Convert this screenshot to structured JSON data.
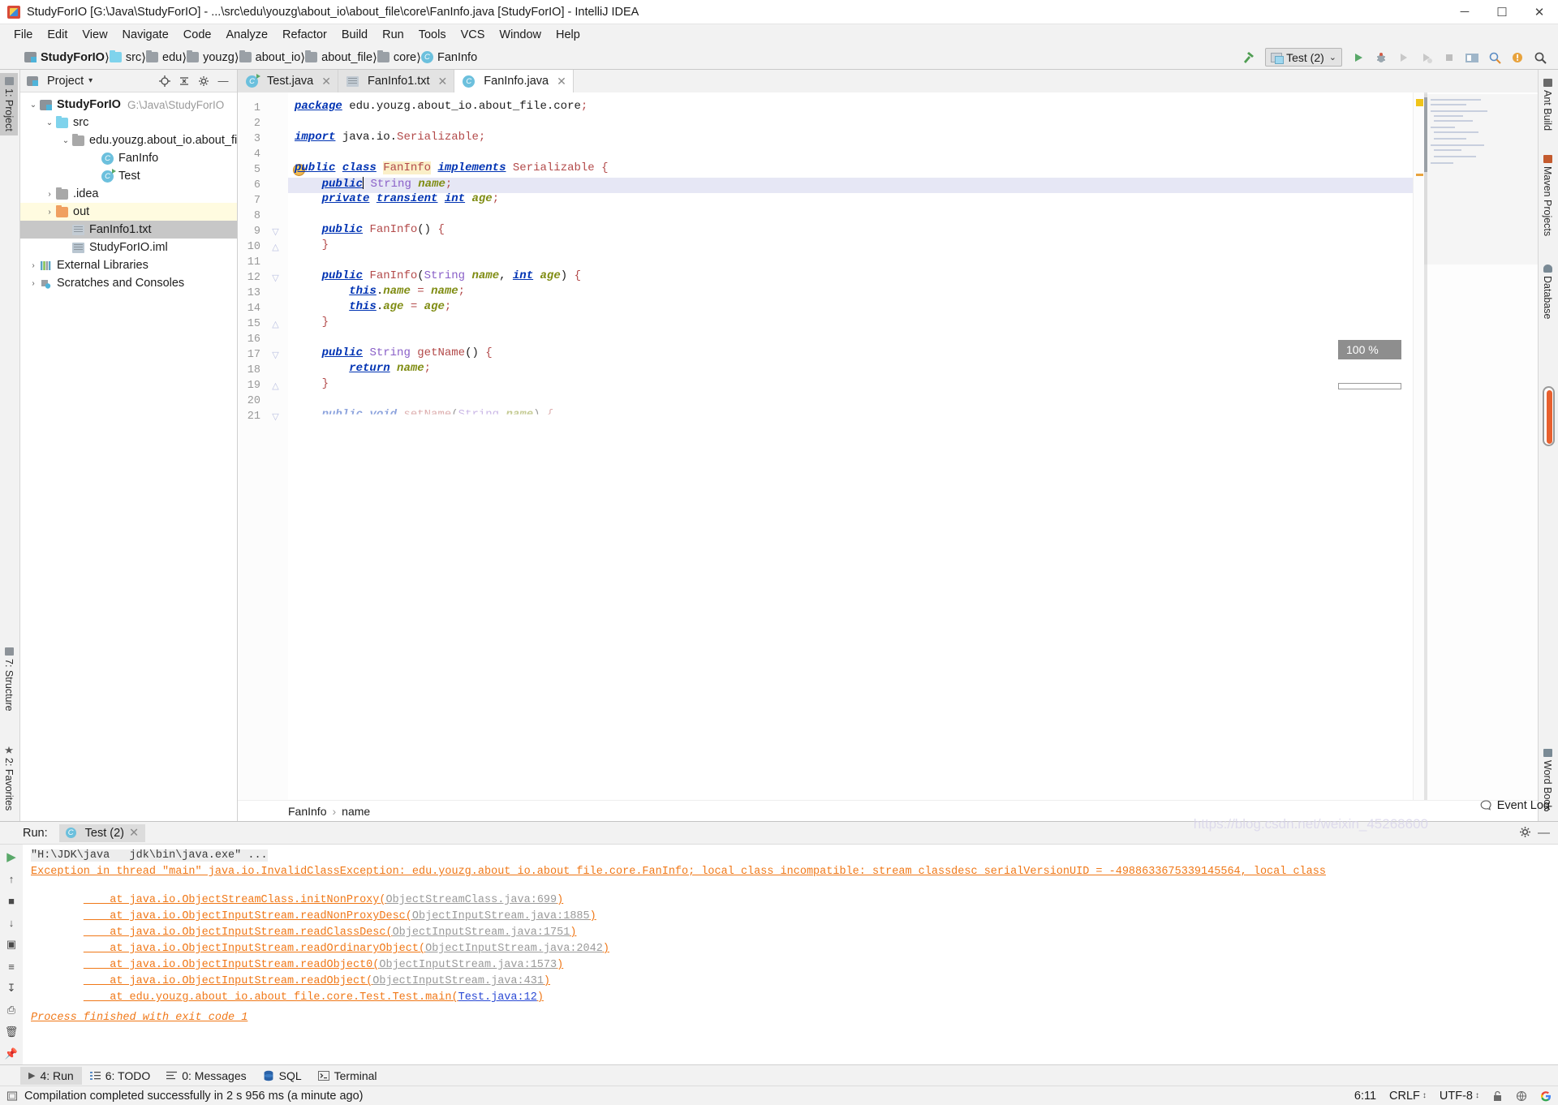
{
  "window": {
    "title": "StudyForIO [G:\\Java\\StudyForIO] - ...\\src\\edu\\youzg\\about_io\\about_file\\core\\FanInfo.java [StudyForIO] - IntelliJ IDEA",
    "minimize": "─",
    "maximize": "☐",
    "close": "✕"
  },
  "menu": [
    {
      "label": "File"
    },
    {
      "label": "Edit"
    },
    {
      "label": "View"
    },
    {
      "label": "Navigate"
    },
    {
      "label": "Code"
    },
    {
      "label": "Analyze"
    },
    {
      "label": "Refactor"
    },
    {
      "label": "Build"
    },
    {
      "label": "Run"
    },
    {
      "label": "Tools"
    },
    {
      "label": "VCS"
    },
    {
      "label": "Window"
    },
    {
      "label": "Help"
    }
  ],
  "breadcrumb": [
    {
      "label": "StudyForIO",
      "icon": "project-icon"
    },
    {
      "label": "src",
      "icon": "folder-icon"
    },
    {
      "label": "edu",
      "icon": "folder-icon"
    },
    {
      "label": "youzg",
      "icon": "folder-icon"
    },
    {
      "label": "about_io",
      "icon": "folder-icon"
    },
    {
      "label": "about_file",
      "icon": "folder-icon"
    },
    {
      "label": "core",
      "icon": "folder-icon"
    },
    {
      "label": "FanInfo",
      "icon": "class-icon"
    }
  ],
  "toolbar": {
    "run_config": "Test (2)",
    "chevron": "⌄"
  },
  "left_strips": [
    {
      "label": "1: Project"
    },
    {
      "label": "7: Structure"
    },
    {
      "label": "2: Favorites"
    }
  ],
  "right_strips": [
    {
      "label": "Ant Build"
    },
    {
      "label": "Maven Projects"
    },
    {
      "label": "Database"
    },
    {
      "label": "Word Book"
    }
  ],
  "project_panel": {
    "title": "Project",
    "caret": "▾",
    "tree": [
      {
        "label": "StudyForIO",
        "sub": "G:\\Java\\StudyForIO",
        "depth": 0,
        "arrow": "⌄",
        "icon": "project-icon",
        "bold": true,
        "state": ""
      },
      {
        "label": "src",
        "sub": "",
        "depth": 1,
        "arrow": "⌄",
        "icon": "folder-blue-icon",
        "bold": false,
        "state": ""
      },
      {
        "label": "edu.youzg.about_io.about_file.c",
        "sub": "",
        "depth": 2,
        "arrow": "⌄",
        "icon": "package-icon",
        "bold": false,
        "state": ""
      },
      {
        "label": "FanInfo",
        "sub": "",
        "depth": 3,
        "arrow": "",
        "icon": "class-icon",
        "bold": false,
        "state": ""
      },
      {
        "label": "Test",
        "sub": "",
        "depth": 3,
        "arrow": "",
        "icon": "runnable-class-icon",
        "bold": false,
        "state": ""
      },
      {
        "label": ".idea",
        "sub": "",
        "depth": 1,
        "arrow": "›",
        "icon": "folder-grey-icon",
        "bold": false,
        "state": ""
      },
      {
        "label": "out",
        "sub": "",
        "depth": 1,
        "arrow": "›",
        "icon": "folder-orange-icon",
        "bold": false,
        "state": "hl"
      },
      {
        "label": "FanInfo1.txt",
        "sub": "",
        "depth": 2,
        "arrow": "",
        "icon": "text-file-icon",
        "bold": false,
        "state": "sel"
      },
      {
        "label": "StudyForIO.iml",
        "sub": "",
        "depth": 2,
        "arrow": "",
        "icon": "iml-file-icon",
        "bold": false,
        "state": ""
      },
      {
        "label": "External Libraries",
        "sub": "",
        "depth": 0,
        "arrow": "›",
        "icon": "libraries-icon",
        "bold": false,
        "state": ""
      },
      {
        "label": "Scratches and Consoles",
        "sub": "",
        "depth": 0,
        "arrow": "›",
        "icon": "scratches-icon",
        "bold": false,
        "state": ""
      }
    ]
  },
  "editor": {
    "tabs": [
      {
        "label": "Test.java",
        "icon": "runnable-class-icon",
        "active": false
      },
      {
        "label": "FanInfo1.txt",
        "icon": "text-file-icon",
        "active": false
      },
      {
        "label": "FanInfo.java",
        "icon": "class-icon",
        "active": true
      }
    ],
    "line_numbers": [
      "1",
      "2",
      "3",
      "4",
      "5",
      "6",
      "7",
      "8",
      "9",
      "10",
      "11",
      "12",
      "13",
      "14",
      "15",
      "16",
      "17",
      "18",
      "19",
      "20",
      "21"
    ],
    "code": [
      "package edu.youzg.about_io.about_file.core;",
      "",
      "import java.io.Serializable;",
      "",
      "public class FanInfo implements Serializable {",
      "    public String name;",
      "    private transient int age;",
      "",
      "    public FanInfo() {",
      "    }",
      "",
      "    public FanInfo(String name, int age) {",
      "        this.name = name;",
      "        this.age = age;",
      "    }",
      "",
      "    public String getName() {",
      "        return name;",
      "    }",
      "",
      "    public void setName(String name) {"
    ],
    "highlighted_line": 6,
    "highlighted_word": "FanInfo",
    "zoom_badge": "100 %",
    "crumb": [
      "FanInfo",
      "name"
    ],
    "crumb_sep": "›"
  },
  "run_panel": {
    "label": "Run:",
    "tab": "Test (2)",
    "tab_close": "✕",
    "console": [
      {
        "text": "\"H:\\JDK\\java   jdk\\bin\\java.exe\" ...",
        "style": "cmd"
      },
      {
        "text": "Exception in thread \"main\" java.io.InvalidClassException: edu.youzg.about_io.about_file.core.FanInfo; local class incompatible: stream classdesc serialVersionUID = -4988633675339145564, local class",
        "style": "err"
      },
      {
        "text": "    at java.io.ObjectStreamClass.initNonProxy(",
        "link": "ObjectStreamClass.java:699",
        "tail": ")",
        "style": "err"
      },
      {
        "text": "    at java.io.ObjectInputStream.readNonProxyDesc(",
        "link": "ObjectInputStream.java:1885",
        "tail": ")",
        "style": "err"
      },
      {
        "text": "    at java.io.ObjectInputStream.readClassDesc(",
        "link": "ObjectInputStream.java:1751",
        "tail": ")",
        "style": "err"
      },
      {
        "text": "    at java.io.ObjectInputStream.readOrdinaryObject(",
        "link": "ObjectInputStream.java:2042",
        "tail": ")",
        "style": "err"
      },
      {
        "text": "    at java.io.ObjectInputStream.readObject0(",
        "link": "ObjectInputStream.java:1573",
        "tail": ")",
        "style": "err"
      },
      {
        "text": "    at java.io.ObjectInputStream.readObject(",
        "link": "ObjectInputStream.java:431",
        "tail": ")",
        "style": "err"
      },
      {
        "text": "    at edu.youzg.about_io.about_file.core.Test.Test.main(",
        "link": "Test.java:12",
        "tail": ")",
        "style": "err-blue"
      },
      {
        "text": "",
        "style": "blank"
      },
      {
        "text": "Process finished with exit code 1",
        "style": "done"
      }
    ]
  },
  "tool_window_bar": [
    {
      "label": "4: Run",
      "icon": "run-icon",
      "active": true
    },
    {
      "label": "6: TODO",
      "icon": "todo-icon",
      "active": false
    },
    {
      "label": "0: Messages",
      "icon": "messages-icon",
      "active": false
    },
    {
      "label": "SQL",
      "icon": "database-icon",
      "active": false
    },
    {
      "label": "Terminal",
      "icon": "terminal-icon",
      "active": false
    }
  ],
  "status_bar": {
    "message": "Compilation completed successfully in 2 s 956 ms (a minute ago)",
    "caret_position": "6:11",
    "line_separator": "CRLF",
    "encoding": "UTF-8",
    "event_log": "Event Log",
    "watermark": "https://blog.csdn.net/weixin_45268600"
  },
  "colors": {
    "keyword": "#0033b3",
    "class_name": "#b34a4a",
    "field": "#7f8c12",
    "error_orange": "#f07818",
    "link_blue": "#2a49d4",
    "selection": "#e6e7f5"
  }
}
